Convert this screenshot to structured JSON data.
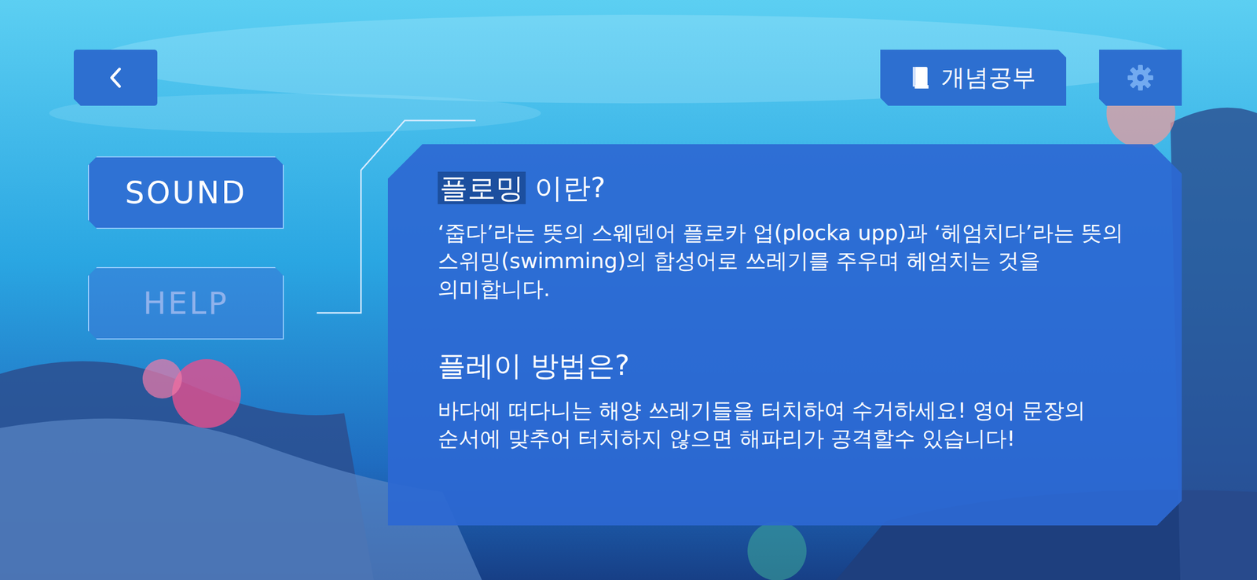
{
  "top_bar": {
    "concept_button": {
      "label": "개념공부"
    }
  },
  "menu": [
    {
      "label": "SOUND",
      "selected": false
    },
    {
      "label": "HELP",
      "selected": true
    }
  ],
  "help_panel": {
    "sections": [
      {
        "title": [
          {
            "text": "플로밍",
            "highlighted": true
          },
          {
            "text": " 이란?",
            "highlighted": false
          }
        ],
        "body": "‘줍다’라는 뜻의 스웨덴어 플로카 업(plocka upp)과 ‘헤엄치다’라는 뜻의 스위밍(swimming)의 합성어로 쓰레기를 주우며 헤엄치는 것을 의미합니다."
      },
      {
        "title": [
          {
            "text": "플레이 방법은?",
            "highlighted": false
          }
        ],
        "body": "바다에 떠다니는 해양 쓰레기들을 터치하여 수거하세요! 영어 문장의 순서에 맞추어 터치하지 않으면 해파리가 공격할수 있습니다!"
      }
    ]
  }
}
